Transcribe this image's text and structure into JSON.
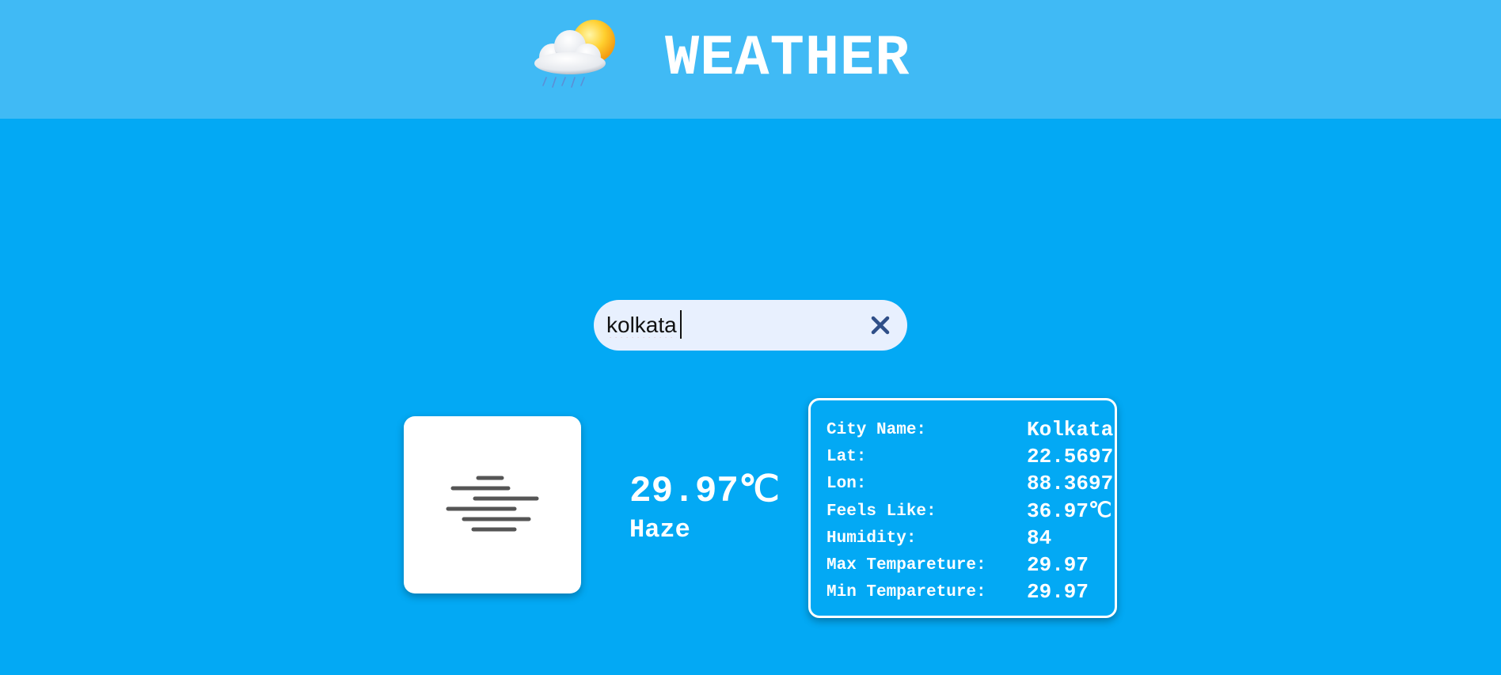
{
  "header": {
    "title": "WEATHER",
    "logo_icon": "cloud-sun-rain-icon",
    "background": "#40baf5"
  },
  "search": {
    "value": "kolkata",
    "clear_icon": "close-icon"
  },
  "current": {
    "icon": "haze-icon",
    "temperature": "29.97℃",
    "condition": "Haze"
  },
  "details": [
    {
      "label": "City Name:",
      "value": "Kolkata"
    },
    {
      "label": "Lat:",
      "value": "22.5697"
    },
    {
      "label": "Lon:",
      "value": "88.3697"
    },
    {
      "label": "Feels Like:",
      "value": "36.97℃"
    },
    {
      "label": "Humidity:",
      "value": "84"
    },
    {
      "label": "Max Tempareture:",
      "value": "29.97"
    },
    {
      "label": "Min Tempareture:",
      "value": "29.97"
    }
  ],
  "colors": {
    "page_background": "#03a9f4",
    "search_background": "#e8f0fe",
    "clear_icon": "#2f4f88",
    "text": "#ffffff"
  }
}
